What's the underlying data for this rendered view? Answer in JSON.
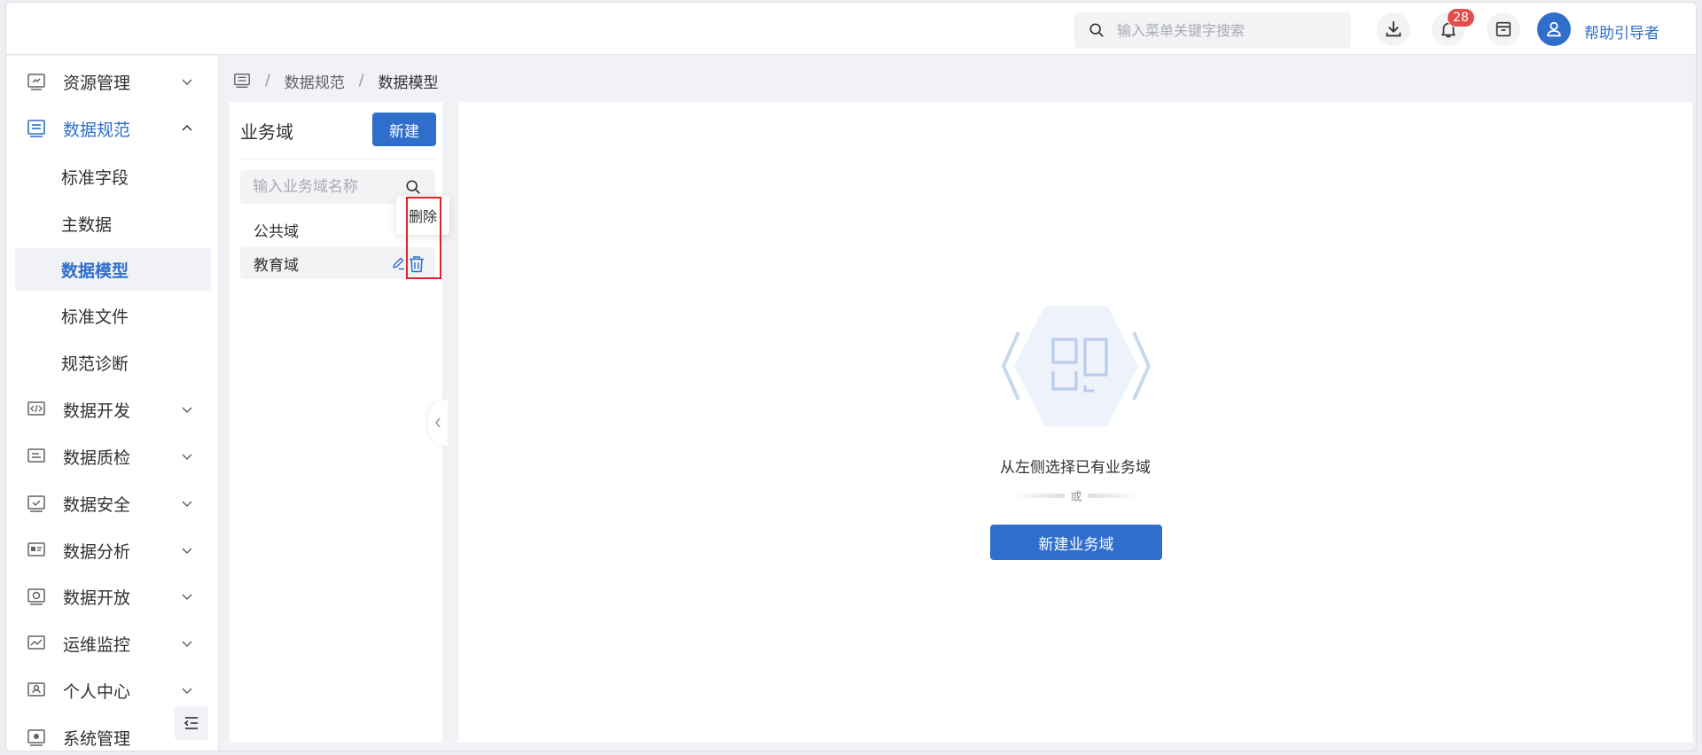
{
  "header": {
    "search_placeholder": "输入菜单关键字搜索",
    "notification_count": "28",
    "user_name": "帮助引导者"
  },
  "sidebar": {
    "items": [
      {
        "label": "资源管理",
        "icon": "resource-icon",
        "expanded": false
      },
      {
        "label": "数据规范",
        "icon": "data-standard-icon",
        "expanded": true
      },
      {
        "label": "数据开发",
        "icon": "code-icon",
        "expanded": false
      },
      {
        "label": "数据质检",
        "icon": "quality-icon",
        "expanded": false
      },
      {
        "label": "数据安全",
        "icon": "security-icon",
        "expanded": false
      },
      {
        "label": "数据分析",
        "icon": "analysis-icon",
        "expanded": false
      },
      {
        "label": "数据开放",
        "icon": "open-icon",
        "expanded": false
      },
      {
        "label": "运维监控",
        "icon": "monitor-icon",
        "expanded": false
      },
      {
        "label": "个人中心",
        "icon": "user-center-icon",
        "expanded": false
      },
      {
        "label": "系统管理",
        "icon": "system-icon",
        "expanded": false
      }
    ],
    "sub_items": [
      {
        "label": "标准字段"
      },
      {
        "label": "主数据"
      },
      {
        "label": "数据模型",
        "selected": true
      },
      {
        "label": "标准文件"
      },
      {
        "label": "规范诊断"
      }
    ]
  },
  "breadcrumb": {
    "items": [
      "数据规范",
      "数据模型"
    ],
    "separator": "/"
  },
  "domain_panel": {
    "title": "业务域",
    "new_button": "新建",
    "search_placeholder": "输入业务域名称",
    "domains": [
      {
        "name": "公共域"
      },
      {
        "name": "教育域",
        "hovered": true
      }
    ],
    "tooltip": "删除"
  },
  "main": {
    "empty_text": "从左侧选择已有业务域",
    "or_text": "或",
    "create_button": "新建业务域"
  },
  "colors": {
    "primary": "#2f6ecb",
    "badge": "#e34d4d",
    "highlight": "#e02424"
  }
}
